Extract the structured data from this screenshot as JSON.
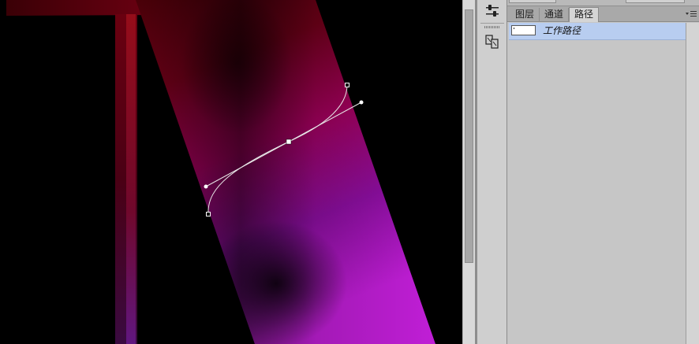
{
  "canvas": {
    "description_colors": {
      "letter_top": "#6a0010",
      "letter_mid": "#9a005c",
      "letter_bottom": "#b218c8"
    }
  },
  "toolstrip": {
    "icons": [
      "adjust-sliders-icon",
      "clone-source-icon"
    ]
  },
  "panel": {
    "tabs": [
      {
        "label": "图层",
        "active": false
      },
      {
        "label": "通道",
        "active": false
      },
      {
        "label": "路径",
        "active": true
      }
    ],
    "paths": [
      {
        "label": "工作路径",
        "selected": true
      }
    ],
    "selection_color": "#b8cdf0"
  }
}
